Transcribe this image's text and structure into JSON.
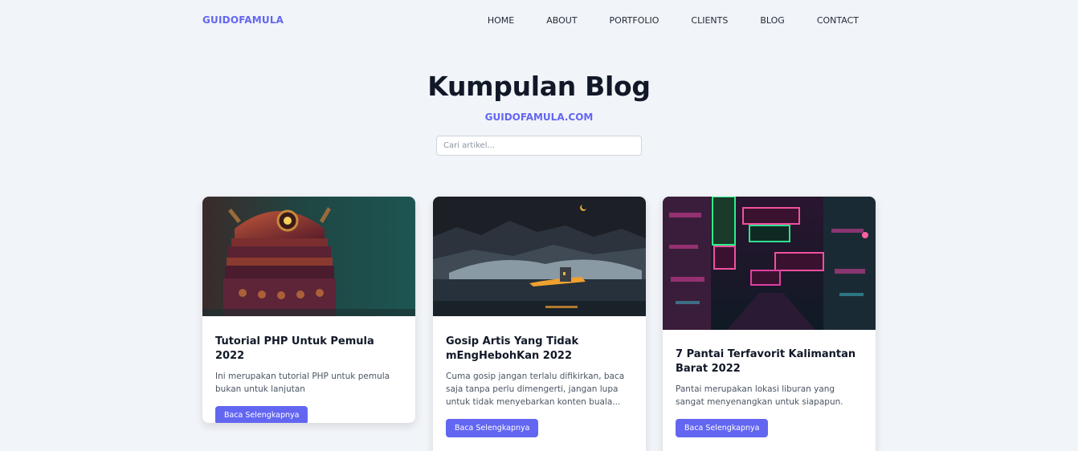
{
  "nav": {
    "brand": "GUIDOFAMULA",
    "items": [
      {
        "label": "HOME"
      },
      {
        "label": "ABOUT"
      },
      {
        "label": "PORTFOLIO"
      },
      {
        "label": "CLIENTS"
      },
      {
        "label": "BLOG"
      },
      {
        "label": "CONTACT"
      }
    ]
  },
  "hero": {
    "title": "Kumpulan Blog",
    "subtitle": "GUIDOFAMULA.COM"
  },
  "search": {
    "placeholder": "Cari artikel..."
  },
  "cards": [
    {
      "image": "robot-dalek-illustration",
      "title": "Tutorial PHP Untuk Pemula 2022",
      "description": "Ini merupakan tutorial PHP untuk pemula bukan untuk lanjutan",
      "button": "Baca Selengkapnya"
    },
    {
      "image": "night-mountain-lake-illustration",
      "title": "Gosip Artis Yang Tidak mEngHebohKan 2022",
      "description": "Cuma gosip jangan terlalu difikirkan, baca saja tanpa perlu dimengerti, jangan lupa untuk tidak menyebarkan konten buala...",
      "button": "Baca Selengkapnya"
    },
    {
      "image": "neon-city-street-photo",
      "title": "7 Pantai Terfavorit Kalimantan Barat 2022",
      "description": "Pantai merupakan lokasi liburan yang sangat menyenangkan untuk siapapun.",
      "button": "Baca Selengkapnya"
    }
  ],
  "colors": {
    "accent": "#6366f1",
    "background": "#f1f4f8",
    "text": "#111827"
  }
}
